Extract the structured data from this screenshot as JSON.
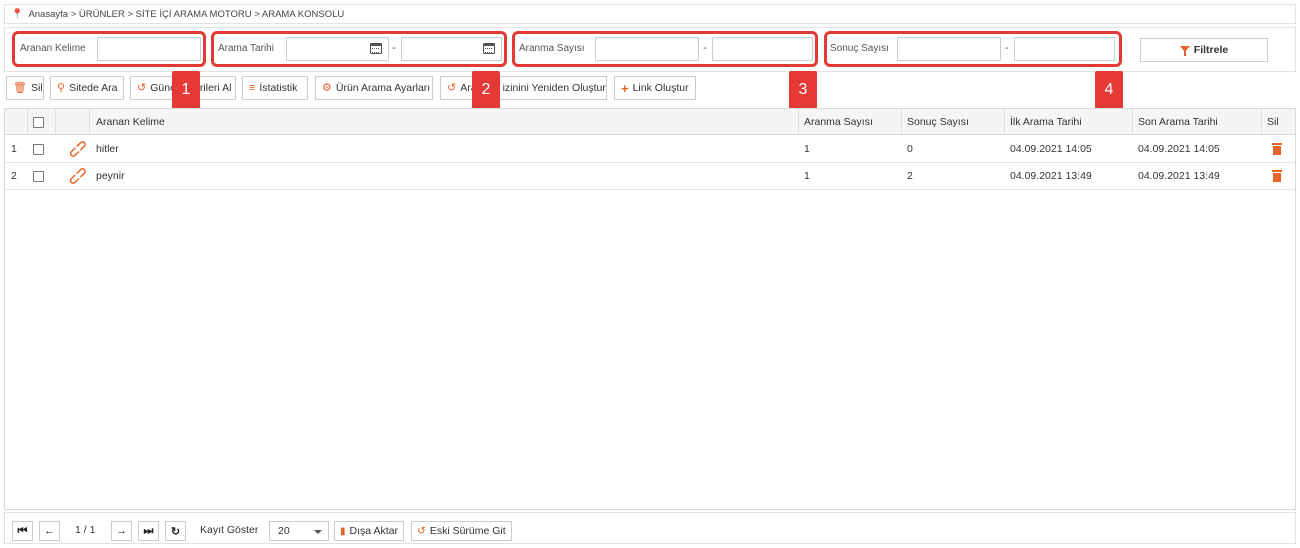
{
  "breadcrumb": "Anasayfa > ÜRÜNLER > SİTE İÇİ ARAMA MOTORU > ARAMA KONSOLU",
  "filters": {
    "keyword_label": "Aranan Kelime",
    "keyword_value": "",
    "date_label": "Arama Tarihi",
    "date_from": "",
    "date_to": "",
    "search_count_label": "Aranma Sayısı",
    "search_count_from": "",
    "search_count_to": "",
    "result_count_label": "Sonuç Sayısı",
    "result_count_from": "",
    "result_count_to": "",
    "separator": "-",
    "filter_button": "Filtrele"
  },
  "badges": [
    "1",
    "2",
    "3",
    "4"
  ],
  "toolbar": {
    "delete": "Sil",
    "search_site": "Sitede Ara",
    "update_data_visible": "Güne",
    "update_data_visible_2": "rileri Al",
    "statistics": "İstatistik",
    "product_search_settings": "Ürün Arama Ayarları",
    "rebuild_index_visible": "Ara",
    "rebuild_index_visible_2": "izinini Yeniden Oluştur",
    "create_link": "Link Oluştur"
  },
  "grid": {
    "columns": [
      "Aranan Kelime",
      "Aranma Sayısı",
      "Sonuç Sayısı",
      "İlk Arama Tarihi",
      "Son Arama Tarihi",
      "Sil"
    ],
    "rows": [
      {
        "no": "1",
        "keyword": "hitler",
        "search_count": "1",
        "result_count": "0",
        "first_date": "04.09.2021 14:05",
        "last_date": "04.09.2021 14:05"
      },
      {
        "no": "2",
        "keyword": "peynir",
        "search_count": "1",
        "result_count": "2",
        "first_date": "04.09.2021 13:49",
        "last_date": "04.09.2021 13:49"
      }
    ]
  },
  "pager": {
    "page_info": "1 / 1",
    "show_records_label": "Kayıt Göster",
    "page_size": "20",
    "export": "Dışa Aktar",
    "old_version": "Eski Sürüme Git"
  },
  "colors": {
    "accent": "#e8632a",
    "highlight": "#e53935"
  }
}
